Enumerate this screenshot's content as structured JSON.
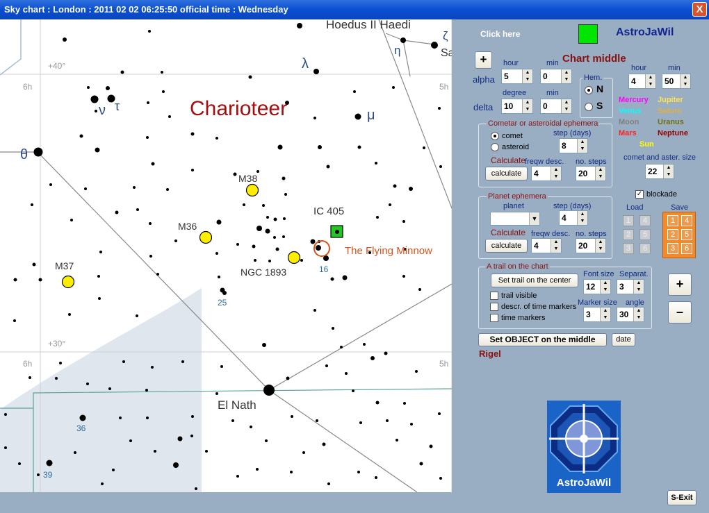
{
  "window": {
    "title": "Sky chart  :  London  :  2011 02 02  06:25:50  official time  :  Wednesday",
    "close_label": "X"
  },
  "sky": {
    "constellation_name": "Charioteer",
    "labels": {
      "hoedus": "Hoedus II Haedi",
      "sa": "Sa",
      "eta": "η",
      "zeta": "ζ",
      "lambda": "λ",
      "nu": "ν",
      "tau": "τ",
      "mu": "μ",
      "theta": "θ",
      "m38": "M38",
      "m36": "M36",
      "m37": "M37",
      "ic405": "IC  405",
      "ngc1893": "NGC 1893",
      "object_name": "The Flying Minnow",
      "n16": "16",
      "n25": "25",
      "n36": "36",
      "n39": "39",
      "el_nath": "El Nath",
      "dec40": "+40°",
      "dec30": "+30°",
      "ra6h_top": "6h",
      "ra5h_top": "5h",
      "ra6h_bottom": "6h",
      "ra5h_bottom": "5h"
    }
  },
  "panel": {
    "click_here": "Click here",
    "brand": "AstroJaWil",
    "chart_middle": "Chart middle",
    "plus_label": "+",
    "alpha_label": "alpha",
    "delta_label": "delta",
    "hour_label": "hour",
    "min_label": "min",
    "degree_label": "degree",
    "min_label2": "min",
    "alpha_hour": "5",
    "alpha_min": "0",
    "delta_deg": "10",
    "delta_min": "0",
    "hem_label": "Hem.",
    "hem_n": "N",
    "hem_s": "S",
    "time_hour_label": "hour",
    "time_min_label": "min",
    "time_hour": "4",
    "time_min": "50",
    "planets": {
      "mercury": "Mercury",
      "jupiter": "Jupiter",
      "venus": "Venus",
      "saturn": "Saturn",
      "moon": "Moon",
      "uranus": "Uranus",
      "mars": "Mars",
      "neptune": "Neptune",
      "sun": "Sun"
    },
    "comet_size_label": "comet and aster. size",
    "comet_size": "22",
    "blockade_label": "blockade",
    "comet_group": {
      "title": "Cometar or asteroidal ephemera",
      "comet": "comet",
      "asteroid": "asteroid",
      "step_label": "step (days)",
      "step": "8",
      "calc_label": "Calculate",
      "calc_btn": "calculate",
      "freq_label": "freqw desc.",
      "freq": "4",
      "steps_label": "no. steps",
      "steps": "20"
    },
    "planet_group": {
      "title": "Planet ephemera",
      "planet_label": "planet",
      "step_label": "step (days)",
      "step": "4",
      "calc_label": "Calculate",
      "calc_btn": "calculate",
      "freq_label": "freqw desc.",
      "freq": "4",
      "steps_label": "no. steps",
      "steps": "20"
    },
    "load_label": "Load",
    "save_label": "Save",
    "slots": [
      "1",
      "4",
      "2",
      "5",
      "3",
      "6"
    ],
    "trail_group": {
      "title": "A trail on the chart",
      "set_btn": "Set trail on the center",
      "font_size_label": "Font size",
      "font_size": "12",
      "separ_label": "Separat.",
      "separ": "3",
      "trail_visible": "trail visible",
      "descr": "descr. of time markers",
      "time_markers": "time markers",
      "marker_label": "Marker size",
      "marker": "3",
      "angle_label": "angle",
      "angle": "30"
    },
    "zoom_plus": "+",
    "zoom_minus": "–",
    "set_object_btn": "Set OBJECT on the middle",
    "date_btn": "date",
    "rigel": "Rigel",
    "logo_text": "AstroJaWil",
    "exit_btn": "S-Exit"
  }
}
